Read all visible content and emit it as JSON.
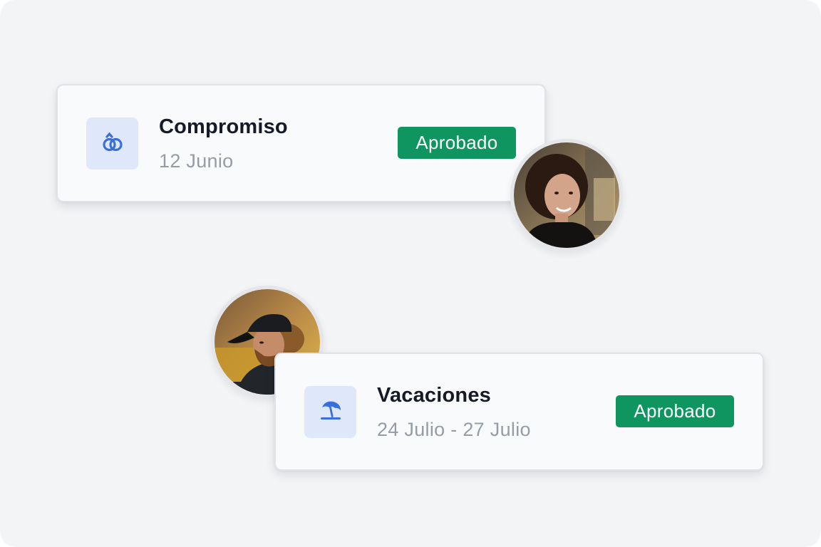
{
  "requests": [
    {
      "title": "Compromiso",
      "date": "12 Junio",
      "status": "Aprobado",
      "icon": "rings-icon",
      "avatar": "woman-avatar"
    },
    {
      "title": "Vacaciones",
      "date": "24 Julio - 27 Julio",
      "status": "Aprobado",
      "icon": "beach-umbrella-icon",
      "avatar": "man-avatar"
    }
  ],
  "colors": {
    "background": "#f3f4f6",
    "card": "#f9fafc",
    "icon_tile": "#dfe8fb",
    "icon": "#3a6fd8",
    "badge": "#0e9560",
    "title": "#141a26",
    "subtitle": "#969ca6"
  }
}
